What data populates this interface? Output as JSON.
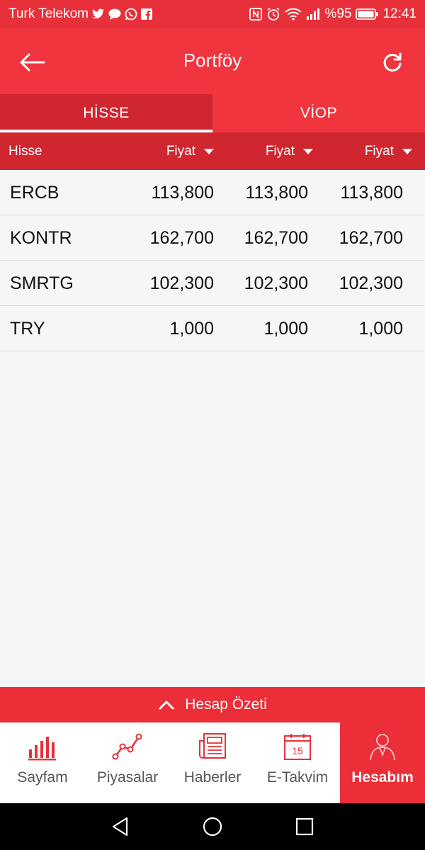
{
  "status_bar": {
    "carrier": "Turk Telekom",
    "battery": "%95",
    "time": "12:41"
  },
  "app_bar": {
    "title": "Portföy"
  },
  "tabs": [
    {
      "label": "HİSSE",
      "active": true
    },
    {
      "label": "VİOP",
      "active": false
    }
  ],
  "table": {
    "columns": [
      "Hisse",
      "Fiyat",
      "Fiyat",
      "Fiyat"
    ],
    "rows": [
      {
        "symbol": "ERCB",
        "values": [
          "113,800",
          "113,800",
          "113,800"
        ]
      },
      {
        "symbol": "KONTR",
        "values": [
          "162,700",
          "162,700",
          "162,700"
        ]
      },
      {
        "symbol": "SMRTG",
        "values": [
          "102,300",
          "102,300",
          "102,300"
        ]
      },
      {
        "symbol": "TRY",
        "values": [
          "1,000",
          "1,000",
          "1,000"
        ]
      }
    ]
  },
  "summary_bar": {
    "label": "Hesap Özeti"
  },
  "bottom_nav": [
    {
      "label": "Sayfam",
      "icon": "bar-chart-icon"
    },
    {
      "label": "Piyasalar",
      "icon": "line-chart-icon"
    },
    {
      "label": "Haberler",
      "icon": "newspaper-icon"
    },
    {
      "label": "E-Takvim",
      "icon": "calendar-icon",
      "badge": "15"
    },
    {
      "label": "Hesabım",
      "icon": "user-icon",
      "active": true
    }
  ],
  "colors": {
    "primary": "#f0353f",
    "dark": "#cf2630",
    "active_nav": "#ec2e38"
  }
}
